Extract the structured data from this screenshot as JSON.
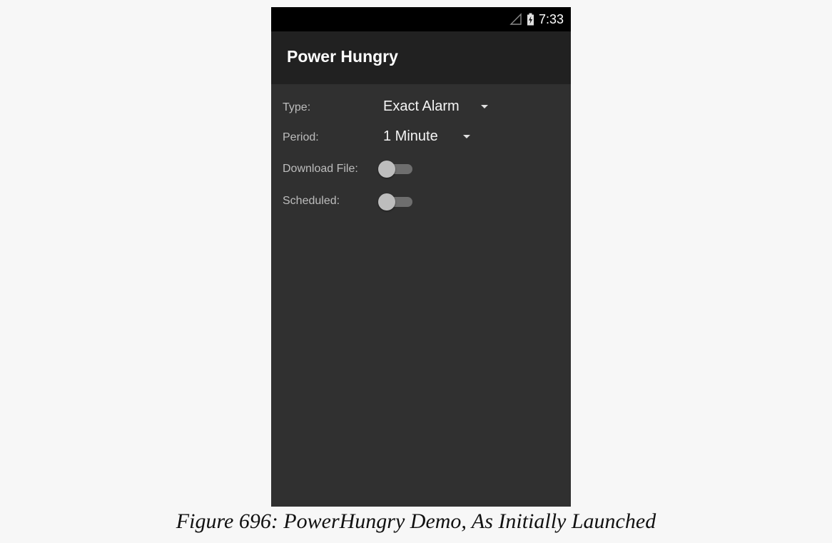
{
  "status_bar": {
    "time": "7:33",
    "icons": [
      "signal-icon",
      "battery-charging-icon"
    ]
  },
  "app_bar": {
    "title": "Power Hungry"
  },
  "form": {
    "type_label": "Type:",
    "type_value": "Exact Alarm",
    "period_label": "Period:",
    "period_value": "1 Minute",
    "download_label": "Download File:",
    "download_on": false,
    "scheduled_label": "Scheduled:",
    "scheduled_on": false
  },
  "caption": "Figure 696: PowerHungry Demo, As Initially Launched",
  "colors": {
    "status_bar": "#000000",
    "app_bar": "#212121",
    "content_bg": "#303030",
    "page_bg": "#f7f7f7"
  }
}
